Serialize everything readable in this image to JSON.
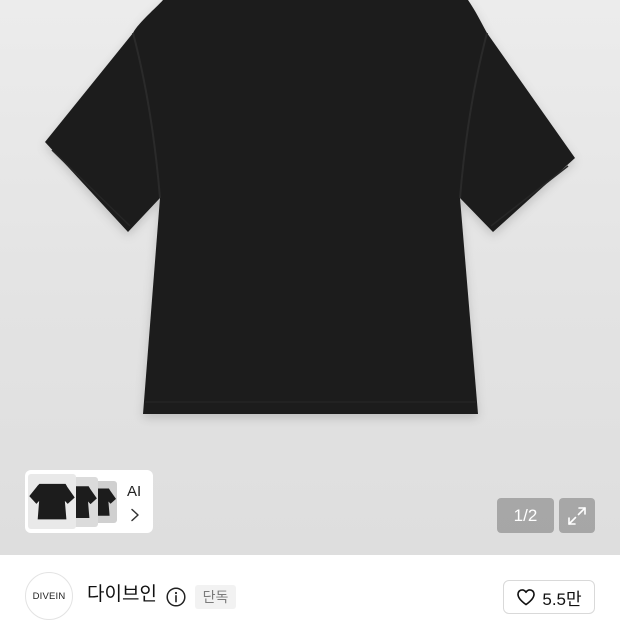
{
  "colors": {
    "image_background": "#e3e3e3",
    "shirt": "#1c1c1c",
    "text_primary": "#111111",
    "badge_background": "#f2f2f2",
    "badge_text": "#7b7b7b",
    "overlay_button": "rgba(0,0,0,0.25)"
  },
  "gallery": {
    "thumbnail_card": {
      "label": "AI",
      "icon": "chevron-right-icon"
    },
    "pager": {
      "current": "1",
      "separator": "/",
      "total": "2"
    },
    "expand_icon": "expand-icon"
  },
  "brand": {
    "logo_text": "DIVEIN",
    "name": "다이브인",
    "info_icon": "info-icon",
    "badge": "단독"
  },
  "like": {
    "icon": "heart-icon",
    "count": "5.5만"
  }
}
